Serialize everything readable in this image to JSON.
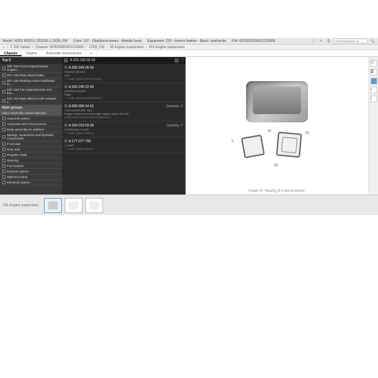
{
  "header": {
    "model": "Model: W253 W253.1.253195-1.253N_FW",
    "color": "Color: 197 - Obsidianschwarz - Metallic lacek",
    "equipment": "Equipment: 229 - Interior leather - Black / anthracite",
    "vin": "FIN: W253253096S1229999",
    "search_placeholder": "Interchangeable nu"
  },
  "breadcrumb": {
    "home": "⌂",
    "sep": "›",
    "p1": "C 200 Sedan",
    "p2": "Chassis: W253999096X229999",
    "p3": "C205_FW",
    "p4": "05 Engine suspension",
    "p5": "015 Engine suspension"
  },
  "tabs": {
    "chassis": "Chassis",
    "engine": "Engine",
    "automatic": "Automatic transmission"
  },
  "sidebar": {
    "top5": "Top 5",
    "items": [
      "005: 015 Front engine/chassis suspen...",
      "007: 020 Rear wheel brake",
      "007: 025 Braking control unit/brake fo...",
      "022: 024 Fan superstructure and fran...",
      "022: 016 Main silencer with exhaust s..."
    ],
    "main_groups": "Main groups",
    "main_sub": "Major assembly swivel selection",
    "groups": [
      "Gearshift system",
      "Automatic MCC encrosorven",
      "Body assembly for platform",
      "Springs, suspension and hydraulic components",
      "Front axle",
      "Rear axle",
      "Propeller shaft",
      "Steering",
      "Fuel system",
      "Exhaust system",
      "Optional extras",
      "Electrical system"
    ]
  },
  "parts": {
    "num_label": "A 205 240 06 00",
    "items": [
      {
        "num": "A 205 240 06 00",
        "desc": "ENGINE MOUNT",
        "sub": "Left",
        "code": "Code: (M264+(M264+651));",
        "qty": ""
      },
      {
        "num": "A 205 240 22 00",
        "desc": "ENGINE MOUNT",
        "sub": "Right",
        "code": "Code: (M264+(M264+651));",
        "qty": ""
      },
      {
        "num": "A 006 990 24 01",
        "desc": "SCHLUSSSCHR. M12",
        "sub": "Engine mount on left and right engine carrier 651000",
        "code": "A:651+M274+M177+M276+M264+M..",
        "qty": "Quantity: 2"
      },
      {
        "num": "A 254 010 03 00",
        "desc": "SCREWING PLATE",
        "sub": "",
        "code": "Code: (M264+M651);",
        "qty": "Quantity: 2"
      },
      {
        "num": "A 177 077 700",
        "desc": "CLAMP",
        "sub": "",
        "code": "Code: (M264+M651);",
        "qty": ""
      }
    ]
  },
  "diagram": {
    "caption": "Image ID: 46uu6g_B || last reviewed:",
    "callouts": {
      "c5": "5",
      "c10": "10",
      "c15": "15",
      "c50": "50"
    }
  },
  "thumbs": {
    "label": "015 Engine suspension"
  }
}
